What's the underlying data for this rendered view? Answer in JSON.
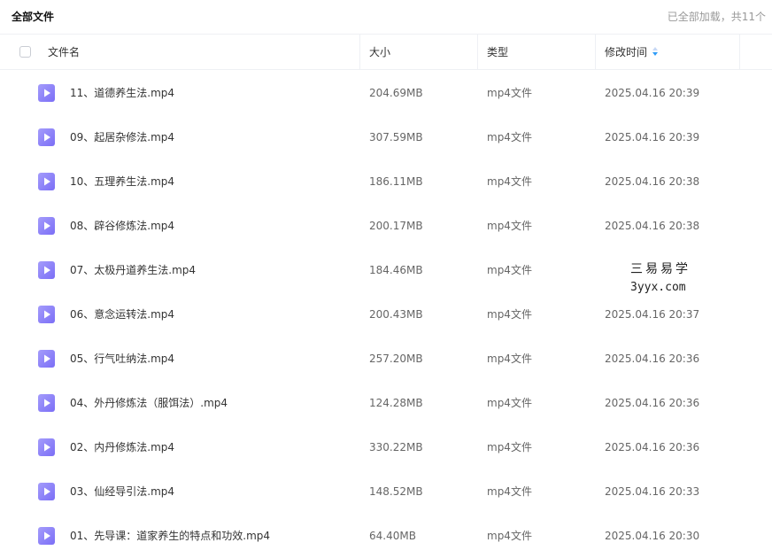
{
  "topbar": {
    "title": "全部文件",
    "status": "已全部加载，共11个"
  },
  "header": {
    "name": "文件名",
    "size": "大小",
    "type": "类型",
    "modified": "修改时间"
  },
  "accent_color": "#2f9cf7",
  "file_icon": "video-file-icon",
  "files": [
    {
      "name": "11、道德养生法.mp4",
      "size": "204.69MB",
      "type": "mp4文件",
      "date": "2025.04.16 20:39"
    },
    {
      "name": "09、起居杂修法.mp4",
      "size": "307.59MB",
      "type": "mp4文件",
      "date": "2025.04.16 20:39"
    },
    {
      "name": "10、五理养生法.mp4",
      "size": "186.11MB",
      "type": "mp4文件",
      "date": "2025.04.16 20:38"
    },
    {
      "name": "08、辟谷修炼法.mp4",
      "size": "200.17MB",
      "type": "mp4文件",
      "date": "2025.04.16 20:38"
    },
    {
      "name": "07、太极丹道养生法.mp4",
      "size": "184.46MB",
      "type": "mp4文件",
      "date": ""
    },
    {
      "name": "06、意念运转法.mp4",
      "size": "200.43MB",
      "type": "mp4文件",
      "date": "2025.04.16 20:37"
    },
    {
      "name": "05、行气吐纳法.mp4",
      "size": "257.20MB",
      "type": "mp4文件",
      "date": "2025.04.16 20:36"
    },
    {
      "name": "04、外丹修炼法（服饵法）.mp4",
      "size": "124.28MB",
      "type": "mp4文件",
      "date": "2025.04.16 20:36"
    },
    {
      "name": "02、内丹修炼法.mp4",
      "size": "330.22MB",
      "type": "mp4文件",
      "date": "2025.04.16 20:36"
    },
    {
      "name": "03、仙经导引法.mp4",
      "size": "148.52MB",
      "type": "mp4文件",
      "date": "2025.04.16 20:33"
    },
    {
      "name": "01、先导课：道家养生的特点和功效.mp4",
      "size": "64.40MB",
      "type": "mp4文件",
      "date": "2025.04.16 20:30"
    }
  ],
  "watermark": {
    "line1": "三易易学",
    "line2": "3yyx.com"
  }
}
